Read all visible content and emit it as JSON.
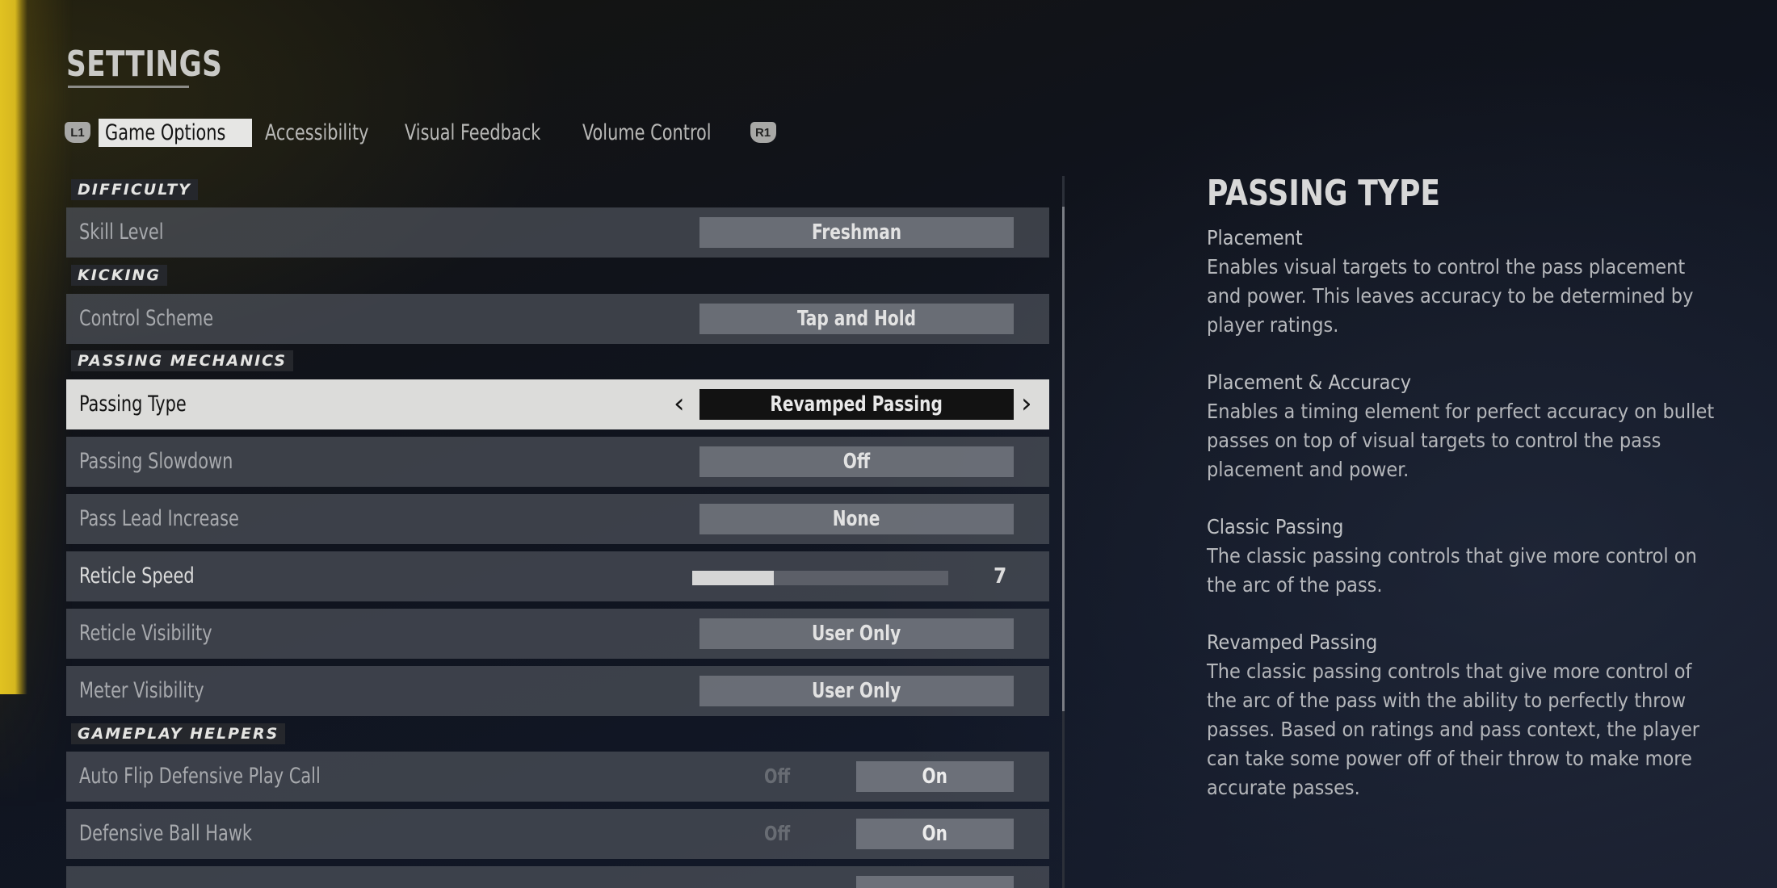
{
  "page": {
    "title": "SETTINGS"
  },
  "tabs": {
    "left_bumper": "L1",
    "right_bumper": "R1",
    "items": [
      {
        "label": "Game Options",
        "active": true
      },
      {
        "label": "Accessibility",
        "active": false
      },
      {
        "label": "Visual Feedback",
        "active": false
      },
      {
        "label": "Volume Control",
        "active": false
      }
    ]
  },
  "sections": {
    "difficulty": "DIFFICULTY",
    "kicking": "KICKING",
    "passing_mechanics": "PASSING MECHANICS",
    "gameplay_helpers": "GAMEPLAY HELPERS"
  },
  "settings": {
    "skill_level": {
      "label": "Skill Level",
      "value": "Freshman"
    },
    "control_scheme": {
      "label": "Control Scheme",
      "value": "Tap and Hold"
    },
    "passing_type": {
      "label": "Passing Type",
      "value": "Revamped Passing",
      "prev_icon": "chevron-left",
      "next_icon": "chevron-right"
    },
    "passing_slowdown": {
      "label": "Passing Slowdown",
      "value": "Off"
    },
    "pass_lead_increase": {
      "label": "Pass Lead Increase",
      "value": "None"
    },
    "reticle_speed": {
      "label": "Reticle Speed",
      "value": "7",
      "fill_fraction": 0.32
    },
    "reticle_visibility": {
      "label": "Reticle Visibility",
      "value": "User Only"
    },
    "meter_visibility": {
      "label": "Meter Visibility",
      "value": "User Only"
    },
    "auto_flip_defensive_play_call": {
      "label": "Auto Flip Defensive Play Call",
      "off_label": "Off",
      "on_label": "On",
      "state": "On"
    },
    "defensive_ball_hawk": {
      "label": "Defensive Ball Hawk",
      "off_label": "Off",
      "on_label": "On",
      "state": "On"
    }
  },
  "info_panel": {
    "title": "PASSING TYPE",
    "options": [
      {
        "name": "Placement",
        "description": "Enables visual targets to control the pass placement and power. This leaves accuracy to be determined by player ratings."
      },
      {
        "name": "Placement & Accuracy",
        "description": "Enables a timing element for perfect accuracy on bullet passes on top of visual targets to control the pass placement and power."
      },
      {
        "name": "Classic Passing",
        "description": "The classic passing controls that give more control on the arc of the pass."
      },
      {
        "name": "Revamped Passing",
        "description": "The classic passing controls that give more control of the arc of the pass with the ability to perfectly throw passes. Based on ratings and pass context, the player can take some power off of their throw to make more accurate passes."
      }
    ]
  },
  "colors": {
    "accent_yellow": "#e1c221",
    "selected_row_bg": "#dcdcda",
    "background": "#0c1019"
  }
}
